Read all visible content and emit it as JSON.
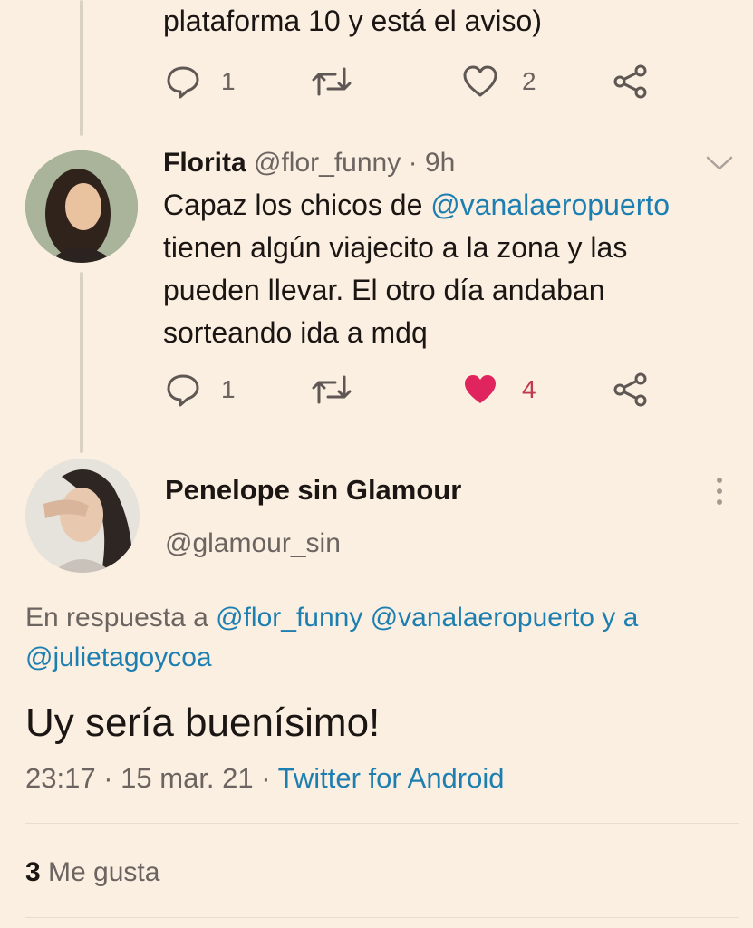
{
  "tweet1": {
    "text_tail": "plataforma 10 y está el aviso)",
    "reply_count": "1",
    "like_count": "2"
  },
  "tweet2": {
    "name": "Florita",
    "handle": "@flor_funny",
    "sep": "·",
    "time": "9h",
    "line1_prefix": "Capaz los chicos de ",
    "line1_mention": "@vanalaeropuerto",
    "line2": "tienen algún viajecito a la zona y las",
    "line3": "pueden llevar. El otro día andaban",
    "line4": "sorteando ida a mdq",
    "reply_count": "1",
    "like_count": "4",
    "like_color": "#e0245e"
  },
  "main_tweet": {
    "name": "Penelope sin Glamour",
    "handle": "@glamour_sin",
    "reply_prefix": "En respuesta a ",
    "reply_mention1": "@flor_funny",
    "reply_mention2": "@vanalaeropuerto",
    "reply_and": " y a",
    "reply_mention3": "@julietagoycoa",
    "text": "Uy sería buenísimo!",
    "time": "23:17",
    "sep1": "·",
    "date": "15 mar. 21",
    "sep2": "·",
    "source": "Twitter for Android",
    "likes_count": "3",
    "likes_label": "Me gusta"
  },
  "colors": {
    "background": "#fbefe1",
    "link": "#1d7fb1",
    "muted": "#6b6460",
    "like_active": "#e0245e"
  }
}
